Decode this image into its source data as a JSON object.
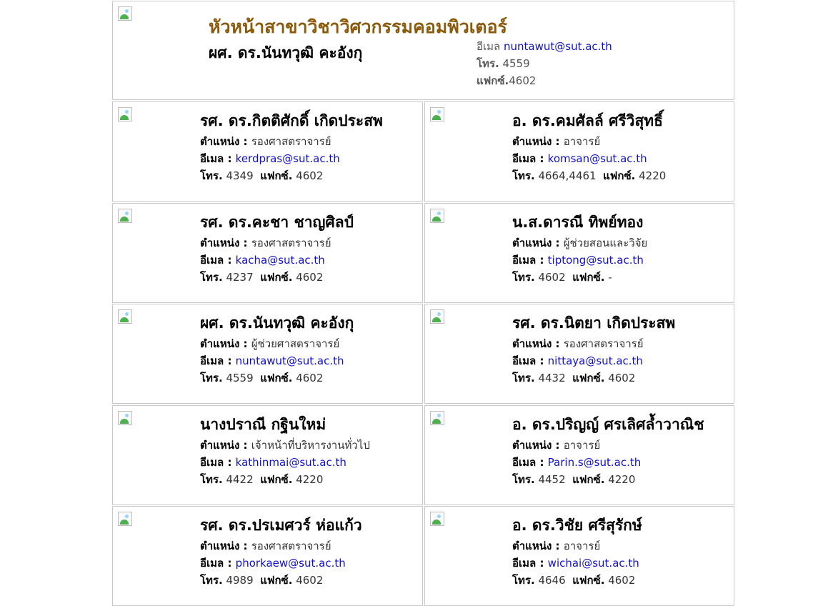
{
  "header": {
    "title": "หัวหน้าสาขาวิชาวิศวกรรมคอมพิวเตอร์",
    "name": "ผศ. ดร.นันทวุฒิ คะอังกุ",
    "email_label": "อีเมล",
    "email": "nuntawut@sut.ac.th",
    "phone_label": "โทร.",
    "phone": " 4559",
    "fax_label": "แฟกซ์.",
    "fax": "4602"
  },
  "labels": {
    "position": "ตำแหน่ง : ",
    "email": "อีเมล : ",
    "phone": "โทร.",
    "fax": "แฟกซ์."
  },
  "people": [
    {
      "name": "รศ. ดร.กิตติศักดิ์ เกิดประสพ",
      "position": "รองศาสตราจารย์",
      "email": "kerdpras@sut.ac.th",
      "phone": " 4349  ",
      "fax": " 4602"
    },
    {
      "name": "อ. ดร.คมศัลล์ ศรีวิสุทธิ์",
      "position": "อาจารย์",
      "email": "komsan@sut.ac.th",
      "phone": " 4664,4461  ",
      "fax": " 4220"
    },
    {
      "name": "รศ. ดร.คะชา ชาญศิลป์",
      "position": "รองศาสตราจารย์",
      "email": "kacha@sut.ac.th",
      "phone": " 4237  ",
      "fax": " 4602"
    },
    {
      "name": "น.ส.ดารณี ทิพย์ทอง",
      "position": "ผู้ช่วยสอนและวิจัย",
      "email": "tiptong@sut.ac.th",
      "phone": " 4602  ",
      "fax": " -"
    },
    {
      "name": "ผศ. ดร.นันทวุฒิ คะอังกุ",
      "position": "ผู้ช่วยศาสตราจารย์",
      "email": "nuntawut@sut.ac.th",
      "phone": " 4559  ",
      "fax": " 4602"
    },
    {
      "name": "รศ. ดร.นิตยา เกิดประสพ",
      "position": "รองศาสตราจารย์",
      "email": "nittaya@sut.ac.th",
      "phone": " 4432  ",
      "fax": " 4602"
    },
    {
      "name": "นางปราณี กฐินใหม่",
      "position": "เจ้าหน้าที่บริหารงานทั่วไป",
      "email": "kathinmai@sut.ac.th",
      "phone": " 4422  ",
      "fax": " 4220"
    },
    {
      "name": "อ. ดร.ปริญญ์ ศรเลิศล้ำวาณิช",
      "position": "อาจารย์",
      "email": "Parin.s@sut.ac.th",
      "phone": " 4452  ",
      "fax": " 4220"
    },
    {
      "name": "รศ. ดร.ปรเมศวร์ ห่อแก้ว",
      "position": "รองศาสตราจารย์",
      "email": "phorkaew@sut.ac.th",
      "phone": " 4989  ",
      "fax": " 4602"
    },
    {
      "name": "อ. ดร.วิชัย ศรีสุรักษ์",
      "position": "อาจารย์",
      "email": "wichai@sut.ac.th",
      "phone": " 4646  ",
      "fax": " 4602"
    }
  ],
  "colors": {
    "title": "#8b5a0a",
    "link": "#1010cc",
    "border": "#c8c8c8"
  }
}
